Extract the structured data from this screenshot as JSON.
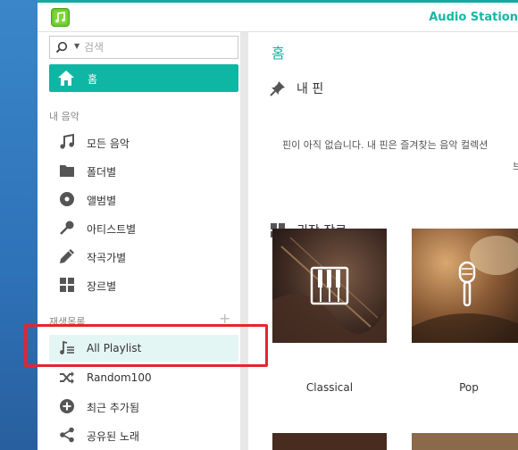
{
  "app": {
    "title": "Audio Station"
  },
  "search": {
    "placeholder": "검색"
  },
  "sidebar": {
    "home_label": "홈",
    "my_music_title": "내 음악",
    "my_music": [
      {
        "label": "모든 음악",
        "icon": "music-note-icon"
      },
      {
        "label": "폴더별",
        "icon": "folder-icon"
      },
      {
        "label": "앨범별",
        "icon": "album-disc-icon"
      },
      {
        "label": "아티스트별",
        "icon": "microphone-icon"
      },
      {
        "label": "작곡가별",
        "icon": "pen-icon"
      },
      {
        "label": "장르별",
        "icon": "grid-icon"
      }
    ],
    "playlist_title": "재생목록",
    "playlists": [
      {
        "label": "All Playlist",
        "icon": "playlist-icon"
      },
      {
        "label": "Random100",
        "icon": "shuffle-icon"
      },
      {
        "label": "최근 추가됨",
        "icon": "plus-circle-icon"
      },
      {
        "label": "공유된 노래",
        "icon": "share-icon"
      }
    ]
  },
  "main": {
    "title": "홈",
    "pins_title": "내 핀",
    "pins_empty": "핀이 아직 없습니다. 내 핀은 즐겨찾는 음악 컬렉션",
    "pins_empty_cont": "브",
    "genres_title": "권장 장르",
    "genres": [
      {
        "label": "Classical",
        "icon": "piano-keys-icon"
      },
      {
        "label": "Pop",
        "icon": "microphone-icon"
      }
    ]
  },
  "colors": {
    "accent": "#0fb6a4",
    "highlight": "#e3262d"
  }
}
